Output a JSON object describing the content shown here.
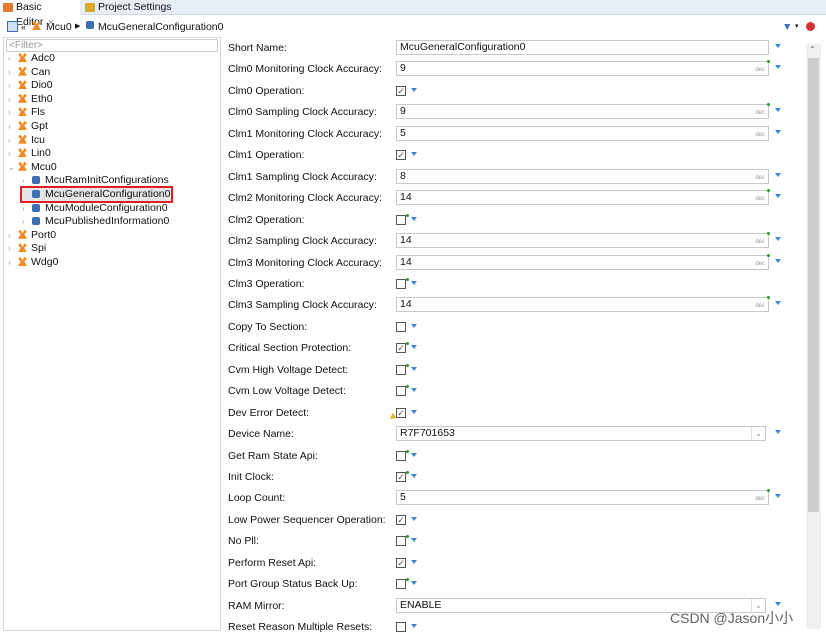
{
  "tabs": [
    {
      "label": "Basic Editor",
      "active": true
    },
    {
      "label": "Project Settings",
      "active": false
    }
  ],
  "breadcrumb": [
    "Mcu0",
    "McuGeneralConfiguration0"
  ],
  "filter_placeholder": "<Filter>",
  "tree": [
    {
      "label": "Adc0",
      "level": 0,
      "icon": "module-icon",
      "expanded": false
    },
    {
      "label": "Can",
      "level": 0,
      "icon": "module-icon",
      "expanded": false
    },
    {
      "label": "Dio0",
      "level": 0,
      "icon": "module-icon",
      "expanded": false
    },
    {
      "label": "Eth0",
      "level": 0,
      "icon": "module-icon",
      "expanded": false
    },
    {
      "label": "Fls",
      "level": 0,
      "icon": "module-icon",
      "expanded": false
    },
    {
      "label": "Gpt",
      "level": 0,
      "icon": "module-icon",
      "expanded": false
    },
    {
      "label": "Icu",
      "level": 0,
      "icon": "module-icon",
      "expanded": false
    },
    {
      "label": "Lin0",
      "level": 0,
      "icon": "module-icon",
      "expanded": false
    },
    {
      "label": "Mcu0",
      "level": 0,
      "icon": "module-icon",
      "expanded": true
    },
    {
      "label": "McuRamInitConfigurations",
      "level": 1,
      "icon": "container-icon",
      "expanded": false
    },
    {
      "label": "McuGeneralConfiguration0",
      "level": 1,
      "icon": "container-icon",
      "selected": true
    },
    {
      "label": "McuModuleConfiguration0",
      "level": 1,
      "icon": "container-icon",
      "expanded": false
    },
    {
      "label": "McuPublishedInformation0",
      "level": 1,
      "icon": "container-icon",
      "expanded": false
    },
    {
      "label": "Port0",
      "level": 0,
      "icon": "module-icon",
      "expanded": false
    },
    {
      "label": "Spi",
      "level": 0,
      "icon": "module-icon",
      "expanded": false
    },
    {
      "label": "Wdg0",
      "level": 0,
      "icon": "module-icon",
      "expanded": false
    }
  ],
  "dec_label": "dec",
  "fields": [
    {
      "label": "Short Name:",
      "type": "text",
      "value": "McuGeneralConfiguration0"
    },
    {
      "label": "Clm0 Monitoring Clock Accuracy:",
      "type": "number",
      "value": "9",
      "modified": true
    },
    {
      "label": "Clm0 Operation:",
      "type": "check",
      "checked": true
    },
    {
      "label": "Clm0 Sampling Clock Accuracy:",
      "type": "number",
      "value": "9",
      "modified": true
    },
    {
      "label": "Clm1 Monitoring Clock Accuracy:",
      "type": "number",
      "value": "5"
    },
    {
      "label": "Clm1 Operation:",
      "type": "check",
      "checked": true
    },
    {
      "label": "Clm1 Sampling Clock Accuracy:",
      "type": "number",
      "value": "8"
    },
    {
      "label": "Clm2 Monitoring Clock Accuracy:",
      "type": "number",
      "value": "14",
      "modified": true
    },
    {
      "label": "Clm2 Operation:",
      "type": "check",
      "checked": false,
      "modified": true
    },
    {
      "label": "Clm2 Sampling Clock Accuracy:",
      "type": "number",
      "value": "14",
      "modified": true
    },
    {
      "label": "Clm3 Monitoring Clock Accuracy:",
      "type": "number",
      "value": "14",
      "modified": true
    },
    {
      "label": "Clm3 Operation:",
      "type": "check",
      "checked": false,
      "modified": true
    },
    {
      "label": "Clm3 Sampling Clock Accuracy:",
      "type": "number",
      "value": "14",
      "modified": true
    },
    {
      "label": "Copy To Section:",
      "type": "check",
      "checked": false
    },
    {
      "label": "Critical Section Protection:",
      "type": "check",
      "checked": true,
      "modified": true
    },
    {
      "label": "Cvm High Voltage Detect:",
      "type": "check",
      "checked": false,
      "modified": true
    },
    {
      "label": "Cvm Low Voltage Detect:",
      "type": "check",
      "checked": false,
      "modified": true
    },
    {
      "label": "Dev Error Detect:",
      "type": "check",
      "checked": true,
      "warning": true
    },
    {
      "label": "Device Name:",
      "type": "combo",
      "value": "R7F701653"
    },
    {
      "label": "Get Ram State Api:",
      "type": "check",
      "checked": false,
      "modified": true
    },
    {
      "label": "Init Clock:",
      "type": "check",
      "checked": true,
      "modified": true
    },
    {
      "label": "Loop Count:",
      "type": "number",
      "value": "5",
      "modified": true
    },
    {
      "label": "Low Power Sequencer Operation:",
      "type": "check",
      "checked": true
    },
    {
      "label": "No Pll:",
      "type": "check",
      "checked": false,
      "modified": true
    },
    {
      "label": "Perform Reset Api:",
      "type": "check",
      "checked": true
    },
    {
      "label": "Port Group Status Back Up:",
      "type": "check",
      "checked": false,
      "modified": true
    },
    {
      "label": "RAM Mirror:",
      "type": "combo",
      "value": "ENABLE"
    },
    {
      "label": "Reset Reason Multiple Resets:",
      "type": "check",
      "checked": false
    }
  ],
  "watermark": "CSDN @Jason小小",
  "colors": {
    "accent": "#3a86d8",
    "modified": "#2a9a2a",
    "selection_outline": "#e02020"
  }
}
